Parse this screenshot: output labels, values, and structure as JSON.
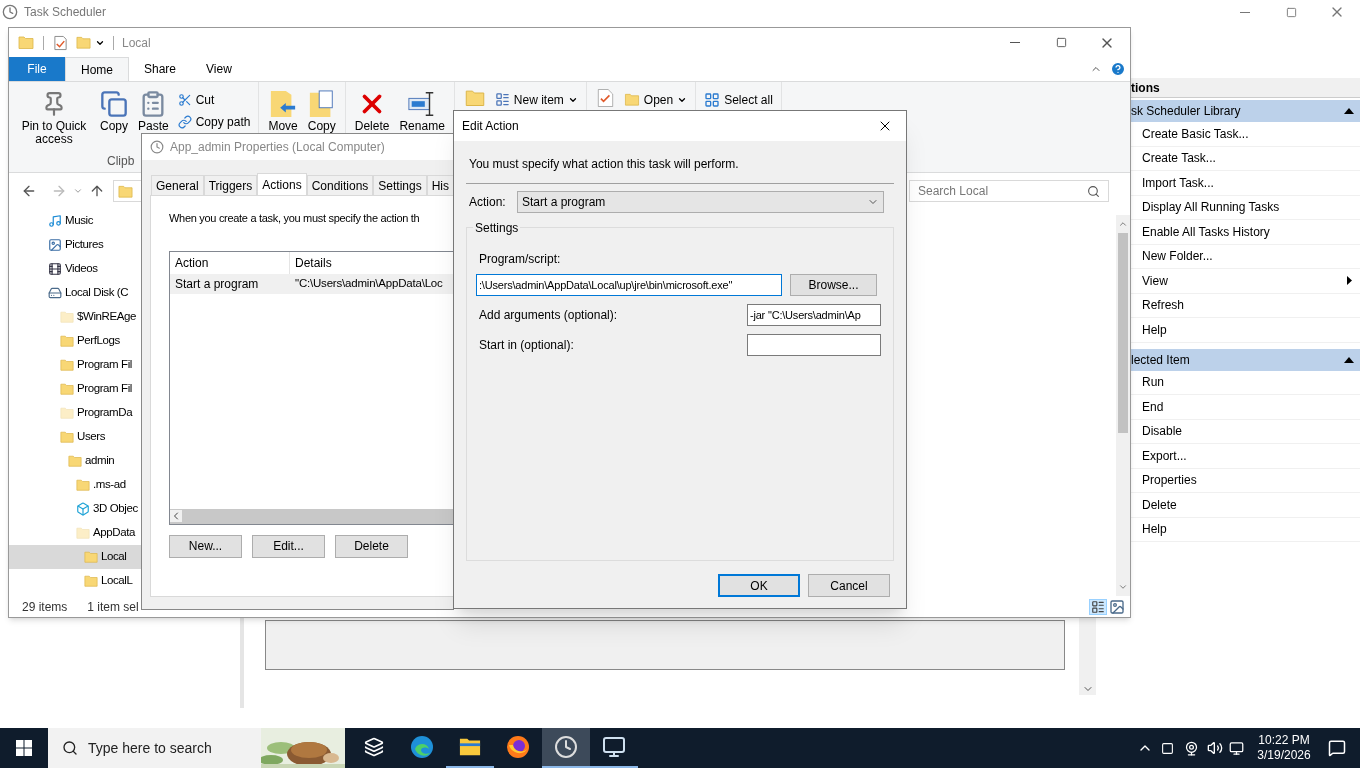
{
  "main_window": {
    "title": "Task Scheduler",
    "actions_pane": {
      "header": "tions",
      "sections": [
        {
          "title": "sk Scheduler Library",
          "expanded": true,
          "items": [
            {
              "label": "Create Basic Task...",
              "kind": "command"
            },
            {
              "label": "Create Task...",
              "kind": "command"
            },
            {
              "label": "Import Task...",
              "kind": "command"
            },
            {
              "label": "Display All Running Tasks",
              "kind": "command"
            },
            {
              "label": "Enable All Tasks History",
              "kind": "command"
            },
            {
              "label": "New Folder...",
              "kind": "command"
            },
            {
              "label": "View",
              "kind": "submenu"
            },
            {
              "label": "Refresh",
              "kind": "command"
            },
            {
              "label": "Help",
              "kind": "command"
            }
          ]
        },
        {
          "title": "lected Item",
          "expanded": true,
          "items": [
            {
              "label": "Run",
              "kind": "command"
            },
            {
              "label": "End",
              "kind": "command"
            },
            {
              "label": "Disable",
              "kind": "command"
            },
            {
              "label": "Export...",
              "kind": "command"
            },
            {
              "label": "Properties",
              "kind": "command"
            },
            {
              "label": "Delete",
              "kind": "command"
            },
            {
              "label": "Help",
              "kind": "command"
            }
          ]
        }
      ]
    }
  },
  "explorer": {
    "title": "Local",
    "ribbon_tabs": [
      {
        "label": "File",
        "kind": "file",
        "selected": false
      },
      {
        "label": "Home",
        "kind": "tab",
        "selected": true
      },
      {
        "label": "Share",
        "kind": "tab",
        "selected": false
      },
      {
        "label": "View",
        "kind": "tab",
        "selected": false
      }
    ],
    "ribbon_groups": [
      {
        "label": "Clipb",
        "items": [
          {
            "label": "Pin to Quick access",
            "kind": "large"
          },
          {
            "label": "Copy",
            "kind": "large"
          },
          {
            "label": "Paste",
            "kind": "large"
          },
          {
            "label": "Cut",
            "kind": "small"
          },
          {
            "label": "Copy path",
            "kind": "small"
          }
        ]
      },
      {
        "items": [
          {
            "label": "Move",
            "kind": "large"
          },
          {
            "label": "Copy",
            "kind": "large"
          }
        ]
      },
      {
        "items": [
          {
            "label": "Delete",
            "kind": "large"
          },
          {
            "label": "Rename",
            "kind": "large"
          }
        ]
      },
      {
        "items": [
          {
            "kind": "icon"
          },
          {
            "label": "New item",
            "kind": "menu"
          }
        ]
      },
      {
        "items": [
          {
            "kind": "icon"
          },
          {
            "label": "Open",
            "kind": "menu"
          }
        ]
      },
      {
        "items": [
          {
            "label": "Select all",
            "kind": "small"
          }
        ]
      }
    ],
    "search": {
      "placeholder": "Search Local"
    },
    "nav_tree": [
      {
        "label": "Music",
        "kind": "music",
        "hidden": false,
        "selected": false
      },
      {
        "label": "Pictures",
        "kind": "pictures",
        "hidden": false,
        "selected": false
      },
      {
        "label": "Videos",
        "kind": "videos",
        "hidden": false,
        "selected": false
      },
      {
        "label": "Local Disk (C",
        "kind": "drive",
        "hidden": false,
        "selected": false,
        "children": [
          {
            "label": "$WinREAge",
            "kind": "folder",
            "hidden": true,
            "selected": false
          },
          {
            "label": "PerfLogs",
            "kind": "folder",
            "hidden": false,
            "selected": false
          },
          {
            "label": "Program Fil",
            "kind": "folder",
            "hidden": false,
            "selected": false
          },
          {
            "label": "Program Fil",
            "kind": "folder",
            "hidden": false,
            "selected": false
          },
          {
            "label": "ProgramDa",
            "kind": "folder",
            "hidden": true,
            "selected": false
          },
          {
            "label": "Users",
            "kind": "folder",
            "hidden": false,
            "selected": false,
            "children": [
              {
                "label": "admin",
                "kind": "folder",
                "hidden": false,
                "selected": false,
                "children": [
                  {
                    "label": ".ms-ad",
                    "kind": "folder",
                    "hidden": false,
                    "selected": false
                  },
                  {
                    "label": "3D Objec",
                    "kind": "cube",
                    "hidden": false,
                    "selected": false
                  },
                  {
                    "label": "AppData",
                    "kind": "folder",
                    "hidden": true,
                    "selected": false,
                    "children": [
                      {
                        "label": "Local",
                        "kind": "folder",
                        "hidden": false,
                        "selected": true
                      },
                      {
                        "label": "LocalL",
                        "kind": "folder",
                        "hidden": false,
                        "selected": false
                      }
                    ]
                  }
                ]
              }
            ]
          }
        ]
      }
    ],
    "status_bar": {
      "item_count": "29 items",
      "selection": "1 item sel"
    }
  },
  "properties_dialog": {
    "title": "App_admin Properties (Local Computer)",
    "tabs": [
      {
        "label": "General",
        "selected": false
      },
      {
        "label": "Triggers",
        "selected": false
      },
      {
        "label": "Actions",
        "selected": true
      },
      {
        "label": "Conditions",
        "selected": false
      },
      {
        "label": "Settings",
        "selected": false
      },
      {
        "label": "His",
        "selected": false
      }
    ],
    "description": "When you create a task, you must specify the action th",
    "table": {
      "columns": [
        "Action",
        "Details"
      ],
      "rows": [
        {
          "cells": [
            "Start a program",
            "\"C:\\Users\\admin\\AppData\\Loc"
          ],
          "selected": true
        }
      ]
    },
    "buttons": [
      "New...",
      "Edit...",
      "Delete"
    ]
  },
  "edit_action_dialog": {
    "title": "Edit Action",
    "instruction": "You must specify what action this task will perform.",
    "action_label": "Action:",
    "action_value": "Start a program",
    "group_title": "Settings",
    "fields": [
      {
        "label": "Program/script:",
        "value": ":\\Users\\admin\\AppData\\Local\\up\\jre\\bin\\microsoft.exe\"",
        "kind": "stacked",
        "focused": true,
        "button": "Browse..."
      },
      {
        "label": "Add arguments (optional):",
        "value": "-jar \"C:\\Users\\admin\\Ap",
        "kind": "inline",
        "focused": false
      },
      {
        "label": "Start in (optional):",
        "kind": "inline",
        "focused": false
      }
    ],
    "buttons": [
      {
        "label": "OK",
        "focused": true
      },
      {
        "label": "Cancel",
        "focused": false
      }
    ]
  },
  "taskbar": {
    "search_placeholder": "Type here to search",
    "apps": [
      {
        "kind": "taskview",
        "running": false,
        "active": false
      },
      {
        "kind": "edge",
        "running": false,
        "active": false
      },
      {
        "kind": "explorer",
        "running": true,
        "active": false
      },
      {
        "kind": "firefox",
        "running": false,
        "active": false
      },
      {
        "kind": "clock",
        "running": true,
        "active": true
      },
      {
        "kind": "monitor",
        "running": true,
        "active": false
      }
    ],
    "time": "10:22 PM",
    "date": "3/19/2026"
  }
}
